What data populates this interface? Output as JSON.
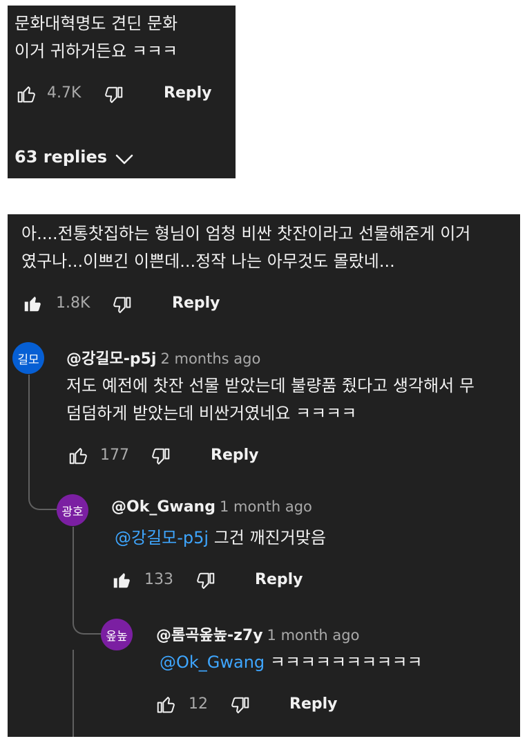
{
  "comment1": {
    "text_line1": "문화대혁명도 견딘 문화",
    "text_line2": "이거 귀하거든요 ㅋㅋㅋ",
    "likes": "4.7K",
    "reply_label": "Reply",
    "replies_toggle": "63 replies"
  },
  "comment2": {
    "text_line1": "아....전통찻집하는 형님이 엄청 비싼 찻잔이라고 선물해준게 이거",
    "text_line2": "였구나...이쁘긴 이쁜데...정작 나는 아무것도 몰랐네...",
    "likes": "1.8K",
    "reply_label": "Reply",
    "replies": [
      {
        "avatar_text": "길모",
        "avatar_color": "#065fd4",
        "author": "@강길모-p5j",
        "time": "2 months ago",
        "text_line1": "저도 예전에 찻잔 선물 받았는데 불량품 줬다고 생각해서 무",
        "text_line2": "덤덤하게 받았는데 비싼거였네요 ㅋㅋㅋㅋ",
        "likes": "177",
        "reply_label": "Reply"
      },
      {
        "avatar_text": "광호",
        "avatar_color": "#7b1fa2",
        "author": "@Ok_Gwang",
        "time": "1 month ago",
        "mention": "@강길모-p5j",
        "text": "그건 깨진거맞음",
        "likes": "133",
        "reply_label": "Reply"
      },
      {
        "avatar_text": "옾높",
        "avatar_color": "#7b1fa2",
        "author": "@롬곡옾높-z7y",
        "time": "1 month ago",
        "mention": "@Ok_Gwang",
        "text": "ㅋㅋㅋㅋㅋㅋㅋㅋㅋㅋ",
        "likes": "12",
        "reply_label": "Reply"
      }
    ]
  },
  "colors": {
    "panel_bg": "#212121",
    "mention": "#3ea6ff",
    "muted": "#aaaaaa"
  }
}
